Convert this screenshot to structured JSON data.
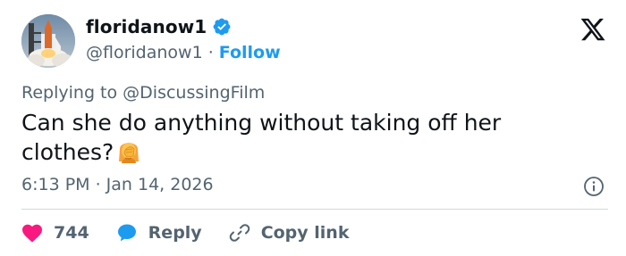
{
  "user": {
    "display_name": "floridanow1",
    "handle": "@floridanow1",
    "separator": "·",
    "follow_label": "Follow",
    "verified": true
  },
  "icons": {
    "avatar": "space-shuttle-launch-avatar",
    "verified": "verified-badge-icon",
    "brand": "x-logo-icon",
    "info": "info-icon",
    "like": "heart-icon",
    "reply": "speech-bubble-icon",
    "copy": "link-icon",
    "emoji": "woman-facepalming-emoji"
  },
  "tweet": {
    "replying_prefix": "Replying to",
    "replying_to": "@DiscussingFilm",
    "text": "Can she do anything without taking off her clothes?",
    "timestamp": "6:13 PM · Jan 14, 2026"
  },
  "actions": {
    "like_count": "744",
    "reply_label": "Reply",
    "copy_label": "Copy link"
  },
  "colors": {
    "accent": "#1d9bf0",
    "like": "#f91880",
    "text": "#0f1419",
    "muted": "#536471"
  }
}
